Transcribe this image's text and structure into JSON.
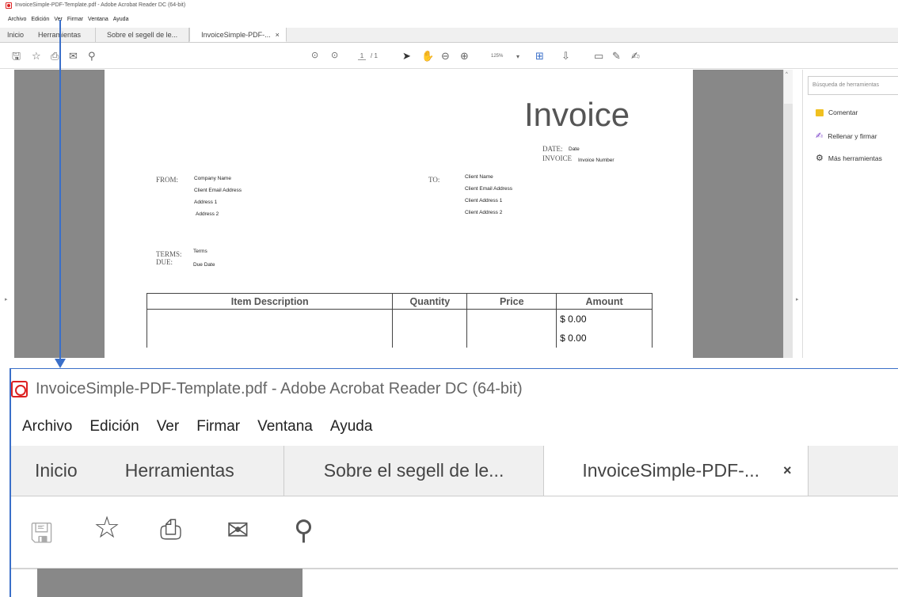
{
  "window": {
    "title": "InvoiceSimple-PDF-Template.pdf - Adobe Acrobat Reader DC (64-bit)"
  },
  "menu": [
    "Archivo",
    "Edición",
    "Ver",
    "Firmar",
    "Ventana",
    "Ayuda"
  ],
  "tabs": {
    "home": "Inicio",
    "tools": "Herramientas",
    "doc1": "Sobre el segell de le...",
    "doc2": "InvoiceSimple-PDF-...",
    "close": "×"
  },
  "toolbar": {
    "page_current": "1",
    "page_total": "/ 1",
    "zoom": "125%"
  },
  "icons": [
    "save-icon",
    "bookmark-star-icon",
    "print-icon",
    "email-icon",
    "search-icon",
    "page-up-icon",
    "page-down-icon",
    "select-cursor-icon",
    "hand-icon",
    "zoom-out-icon",
    "zoom-in-icon",
    "fit-page-icon",
    "scroll-mode-icon",
    "comment-icon",
    "highlight-pen-icon",
    "sign-icon"
  ],
  "invoice": {
    "title": "Invoice",
    "date_label": "DATE:",
    "date_value": "Date",
    "invoice_label": "INVOICE",
    "invoice_value": "Invoice Number",
    "from_label": "FROM:",
    "from": [
      "Company Name",
      "Client Email Address",
      "Address 1",
      "Address 2"
    ],
    "to_label": "TO:",
    "to": [
      "Client Name",
      "Client Email Address",
      "Client Address 1",
      "Client Address 2"
    ],
    "terms_label": "TERMS:",
    "terms_value": "Terms",
    "due_label": "DUE:",
    "due_value": "Due Date",
    "columns": [
      "Item Description",
      "Quantity",
      "Price",
      "Amount"
    ],
    "amounts": [
      "$ 0.00",
      "$ 0.00"
    ]
  },
  "right_panel": {
    "search_placeholder": "Búsqueda de herramientas",
    "items": [
      "Comentar",
      "Rellenar y firmar",
      "Más herramientas"
    ]
  },
  "colors": {
    "accent": "#3a6fc9",
    "pdf_red": "#d22",
    "gray_bg": "#888888"
  }
}
